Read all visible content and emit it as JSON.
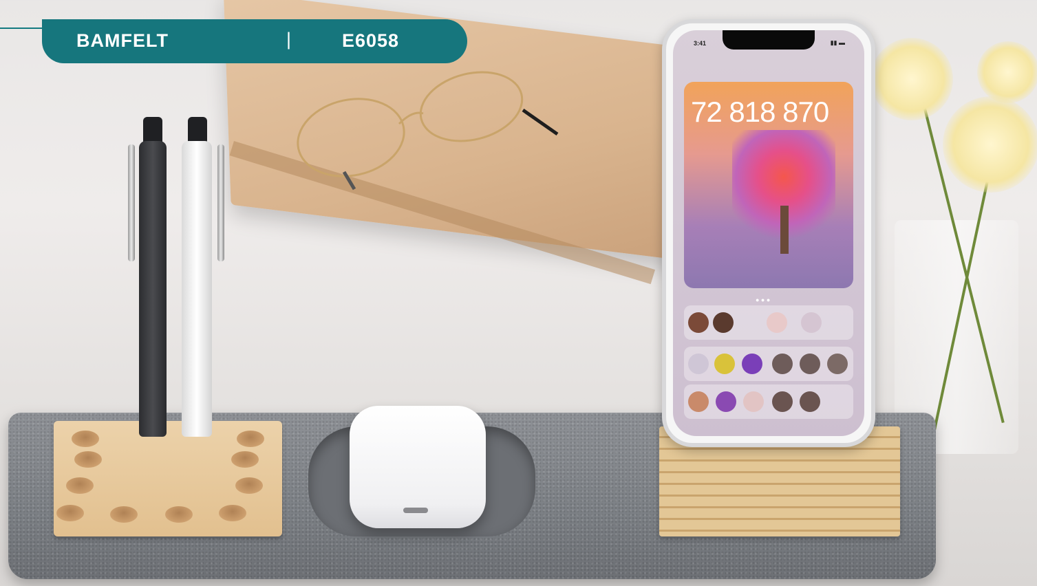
{
  "banner": {
    "product_name": "BAMFELT",
    "separator": "|",
    "product_code": "E6058"
  },
  "phone_screen": {
    "status_time": "3:41",
    "widget_time": "72 818 870"
  },
  "colors": {
    "banner": "#16767d",
    "felt": "#7c8085",
    "bamboo": "#e2c08f"
  }
}
